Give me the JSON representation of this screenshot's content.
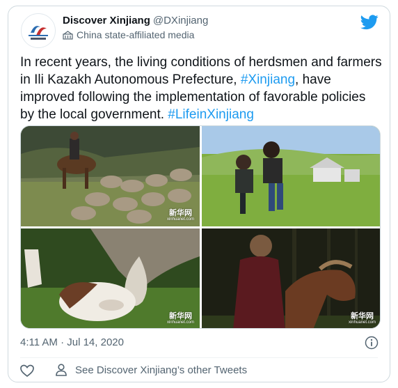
{
  "account": {
    "display_name": "Discover Xinjiang",
    "handle": "@DXinjiang",
    "label": "China state-affiliated media",
    "avatar_icon": "discover-xinjiang-logo-icon"
  },
  "tweet": {
    "text_lead": "In recent years, the living conditions of herdsmen and farmers in Ili Kazakh Autonomous Prefecture, ",
    "hashtag_1": "#Xinjiang",
    "text_mid": ", have improved following the implementation of favorable policies by the local government. ",
    "hashtag_2": "#LifeinXinjiang",
    "timestamp": "4:11 AM · Jul 14, 2020"
  },
  "media": {
    "photos": [
      {
        "subject": "rider on horse herding sheep",
        "watermark": "新华网"
      },
      {
        "subject": "two children playing on grassland near yurt",
        "watermark": ""
      },
      {
        "subject": "cow with newborn calf on grass",
        "watermark": "新华网"
      },
      {
        "subject": "herdsman with horse in dark forest",
        "watermark": "新华网"
      }
    ]
  },
  "actions": {
    "see_other": "See Discover Xinjiang’s other Tweets"
  },
  "colors": {
    "accent": "#1d9bf0",
    "muted_text": "#536471",
    "border": "#cfd9de"
  }
}
